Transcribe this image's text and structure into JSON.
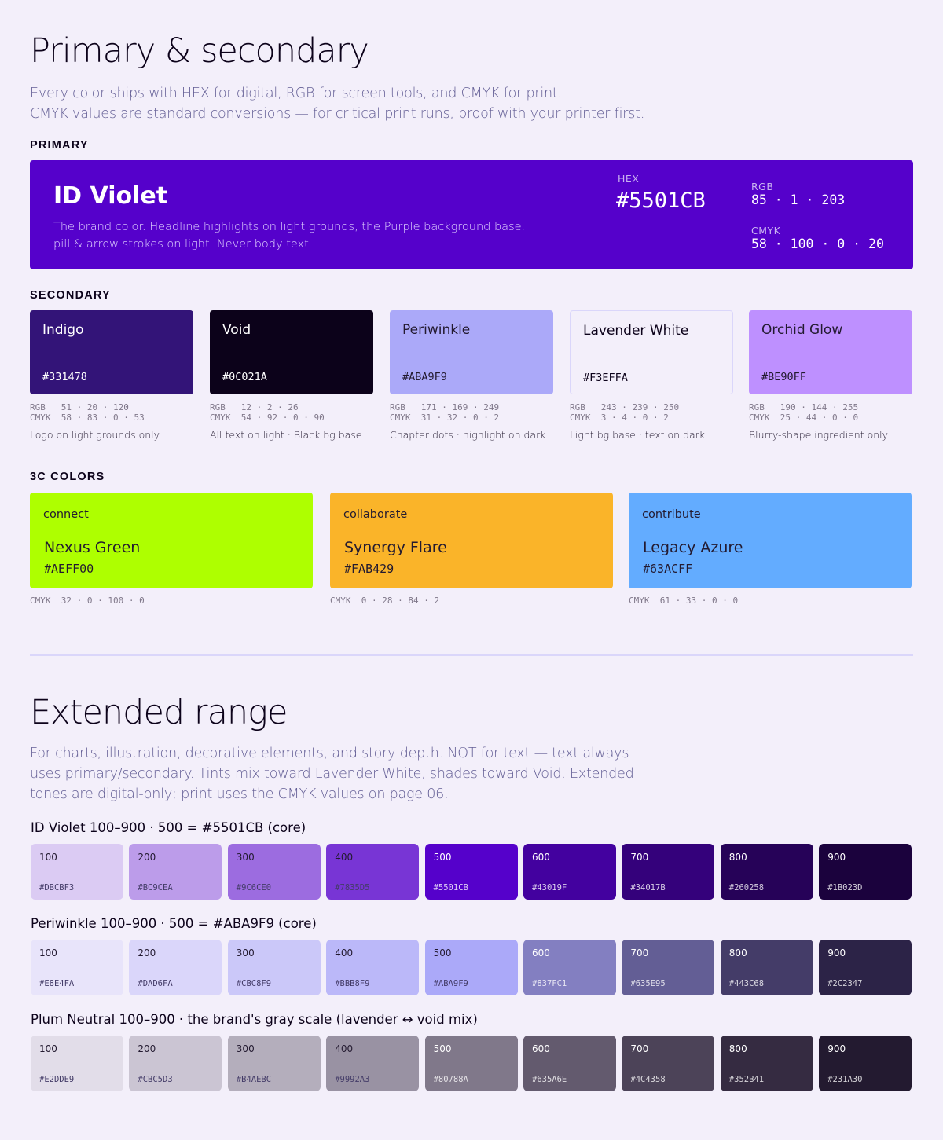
{
  "primary_section": {
    "title": "Primary & secondary",
    "lead": [
      "Every color ships with HEX for digital, RGB for screen tools, and CMYK for print.",
      "CMYK values are standard conversions — for critical print runs, proof with your printer first."
    ],
    "primary_label": "PRIMARY",
    "primary": {
      "name": "ID Violet",
      "desc": [
        "The brand color. Headline highlights on light grounds, the Purple background base,",
        "pill & arrow strokes on light. Never body text."
      ],
      "hex_label": "HEX",
      "hex": "#5501CB",
      "rgb_label": "RGB",
      "rgb": "85 · 1 · 203",
      "cmyk_label": "CMYK",
      "cmyk": "58 · 100 · 0 · 20"
    },
    "secondary_label": "SECONDARY",
    "secondary": [
      {
        "name": "Indigo",
        "hex": "#331478",
        "rgb": "RGB   51 · 20 · 120",
        "cmyk": "CMYK  58 · 83 · 0 · 53",
        "note": "Logo on light grounds only."
      },
      {
        "name": "Void",
        "hex": "#0C021A",
        "rgb": "RGB   12 · 2 · 26",
        "cmyk": "CMYK  54 · 92 · 0 · 90",
        "note": "All text on light · Black bg base."
      },
      {
        "name": "Periwinkle",
        "hex": "#ABA9F9",
        "rgb": "RGB   171 · 169 · 249",
        "cmyk": "CMYK  31 · 32 · 0 · 2",
        "note": "Chapter dots · highlight on dark."
      },
      {
        "name": "Lavender White",
        "hex": "#F3EFFA",
        "rgb": "RGB   243 · 239 · 250",
        "cmyk": "CMYK  3 · 4 · 0 · 2",
        "note": "Light bg base · text on dark."
      },
      {
        "name": "Orchid Glow",
        "hex": "#BE90FF",
        "rgb": "RGB   190 · 144 · 255",
        "cmyk": "CMYK  25 · 44 · 0 · 0",
        "note": "Blurry-shape ingredient only."
      }
    ],
    "c3_label": "3C COLORS",
    "c3": [
      {
        "tag": "connect",
        "name": "Nexus Green",
        "hex": "#AEFF00",
        "cmyk": "CMYK  32 · 0 · 100 · 0"
      },
      {
        "tag": "collaborate",
        "name": "Synergy Flare",
        "hex": "#FAB429",
        "cmyk": "CMYK  0 · 28 · 84 · 2"
      },
      {
        "tag": "contribute",
        "name": "Legacy Azure",
        "hex": "#63ACFF",
        "cmyk": "CMYK  61 · 33 · 0 · 0"
      }
    ]
  },
  "extended_section": {
    "title": "Extended range",
    "lead": [
      "For charts, illustration, decorative elements, and story depth. NOT for text — text always",
      "uses primary/secondary. Tints mix toward Lavender White, shades toward Void. Extended",
      "tones are digital-only; print uses the CMYK values on page 06."
    ],
    "ramps": [
      {
        "title": "ID Violet 100–900 · 500 = #5501CB (core)",
        "chips": [
          {
            "step": "100",
            "hex": "#DBCBF3"
          },
          {
            "step": "200",
            "hex": "#BC9CEA"
          },
          {
            "step": "300",
            "hex": "#9C6CE0"
          },
          {
            "step": "400",
            "hex": "#7835D5"
          },
          {
            "step": "500",
            "hex": "#5501CB"
          },
          {
            "step": "600",
            "hex": "#43019F"
          },
          {
            "step": "700",
            "hex": "#34017B"
          },
          {
            "step": "800",
            "hex": "#260258"
          },
          {
            "step": "900",
            "hex": "#1B023D"
          }
        ]
      },
      {
        "title": "Periwinkle 100–900 · 500 = #ABA9F9 (core)",
        "chips": [
          {
            "step": "100",
            "hex": "#E8E4FA"
          },
          {
            "step": "200",
            "hex": "#DAD6FA"
          },
          {
            "step": "300",
            "hex": "#CBC8F9"
          },
          {
            "step": "400",
            "hex": "#BBB8F9"
          },
          {
            "step": "500",
            "hex": "#ABA9F9"
          },
          {
            "step": "600",
            "hex": "#837FC1"
          },
          {
            "step": "700",
            "hex": "#635E95"
          },
          {
            "step": "800",
            "hex": "#443C68"
          },
          {
            "step": "900",
            "hex": "#2C2347"
          }
        ]
      },
      {
        "title": "Plum Neutral 100–900 · the brand's gray scale (lavender ↔ void mix)",
        "chips": [
          {
            "step": "100",
            "hex": "#E2DDE9"
          },
          {
            "step": "200",
            "hex": "#CBC5D3"
          },
          {
            "step": "300",
            "hex": "#B4AEBC"
          },
          {
            "step": "400",
            "hex": "#9992A3"
          },
          {
            "step": "500",
            "hex": "#80788A"
          },
          {
            "step": "600",
            "hex": "#635A6E"
          },
          {
            "step": "700",
            "hex": "#4C4358"
          },
          {
            "step": "800",
            "hex": "#352B41"
          },
          {
            "step": "900",
            "hex": "#231A30"
          }
        ]
      }
    ]
  }
}
